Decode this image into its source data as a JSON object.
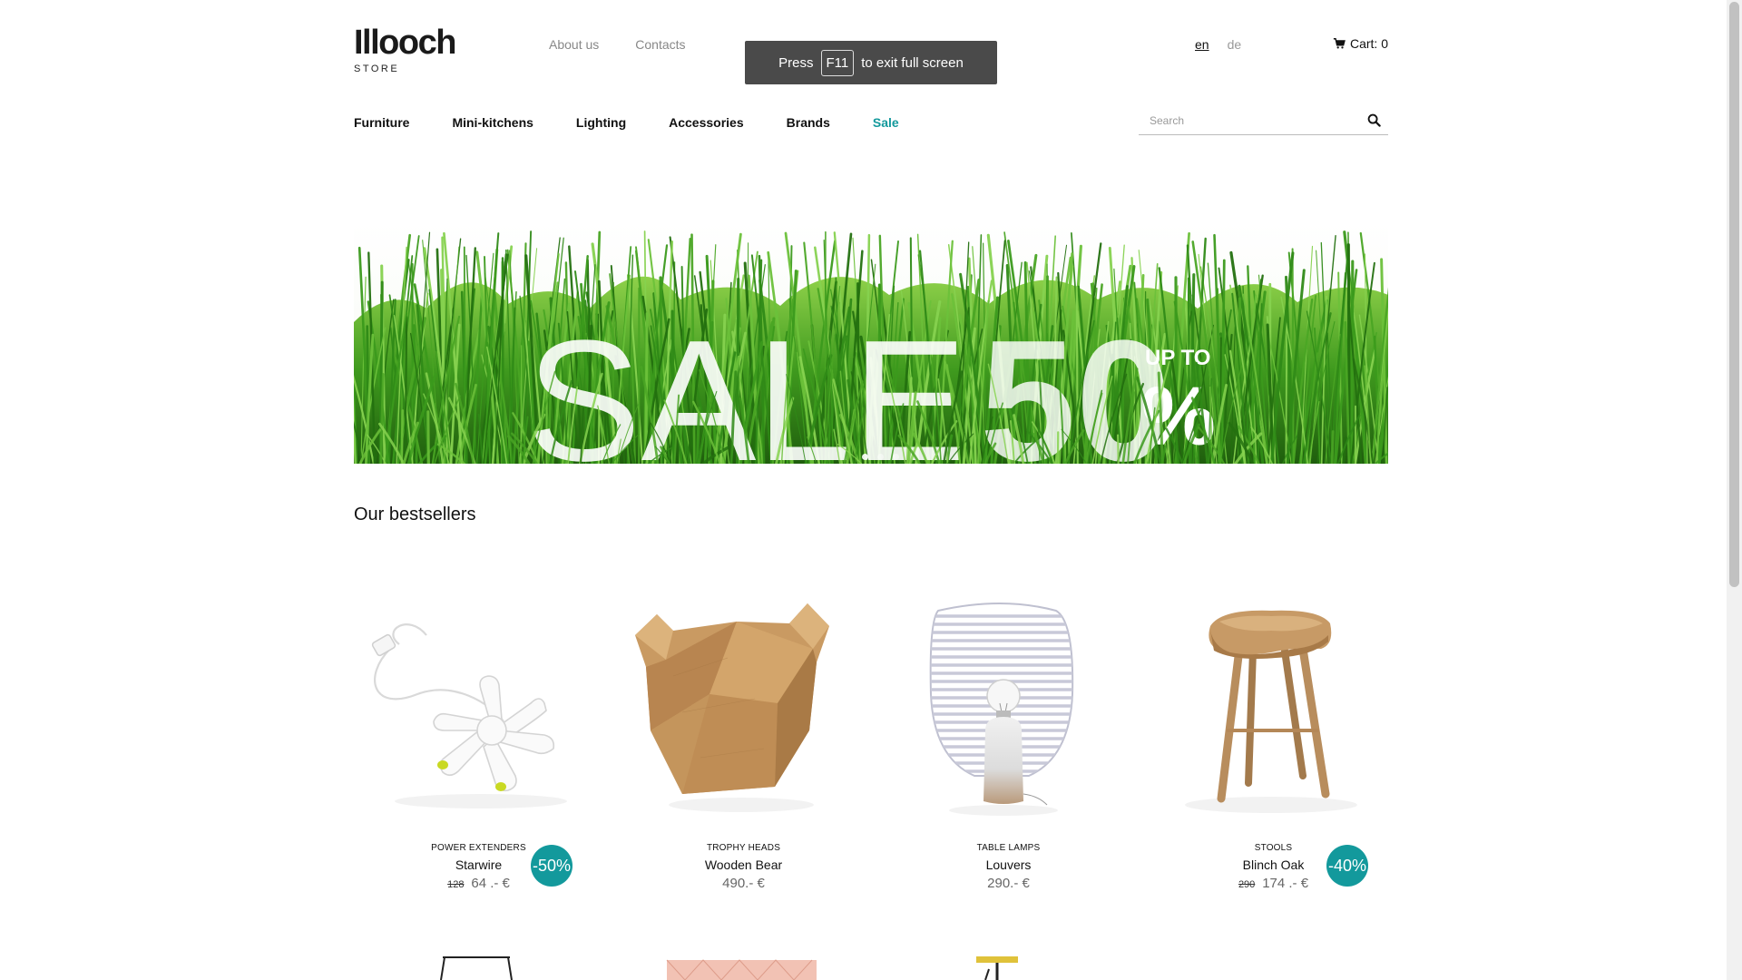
{
  "header": {
    "logo_main": "Illooch",
    "logo_sub": "STORE",
    "links": [
      "About us",
      "Contacts"
    ],
    "languages": [
      {
        "code": "en",
        "active": true
      },
      {
        "code": "de",
        "active": false
      }
    ],
    "cart_label": "Cart: 0"
  },
  "fullscreen_toast": {
    "before": "Press",
    "key": "F11",
    "after": "to exit full screen"
  },
  "nav": {
    "items": [
      "Furniture",
      "Mini-kitchens",
      "Lighting",
      "Accessories",
      "Brands",
      "Sale"
    ],
    "sale_color": "#13999c"
  },
  "search": {
    "placeholder": "Search",
    "value": ""
  },
  "banner": {
    "word": "SALE",
    "percent": "50",
    "up_to": "UP TO",
    "percent_sign": "%",
    "slide_count": 3,
    "active_slide": 1
  },
  "bestsellers": {
    "title": "Our bestsellers",
    "products": [
      {
        "category": "POWER EXTENDERS",
        "name": "Starwire",
        "old_price": "128",
        "price": "64 .- €",
        "badge": "-50%",
        "icon": "power-extender-image"
      },
      {
        "category": "TROPHY HEADS",
        "name": "Wooden Bear",
        "old_price": "",
        "price": "490.- €",
        "badge": "",
        "icon": "wooden-bear-image"
      },
      {
        "category": "TABLE LAMPS",
        "name": "Louvers",
        "old_price": "",
        "price": "290.- €",
        "badge": "",
        "icon": "table-lamp-image"
      },
      {
        "category": "STOOLS",
        "name": "Blinch Oak",
        "old_price": "290",
        "price": "174 .- €",
        "badge": "-40%",
        "icon": "stool-image"
      }
    ]
  },
  "colors": {
    "accent": "#13999c",
    "text": "#111111",
    "muted": "#888888"
  }
}
